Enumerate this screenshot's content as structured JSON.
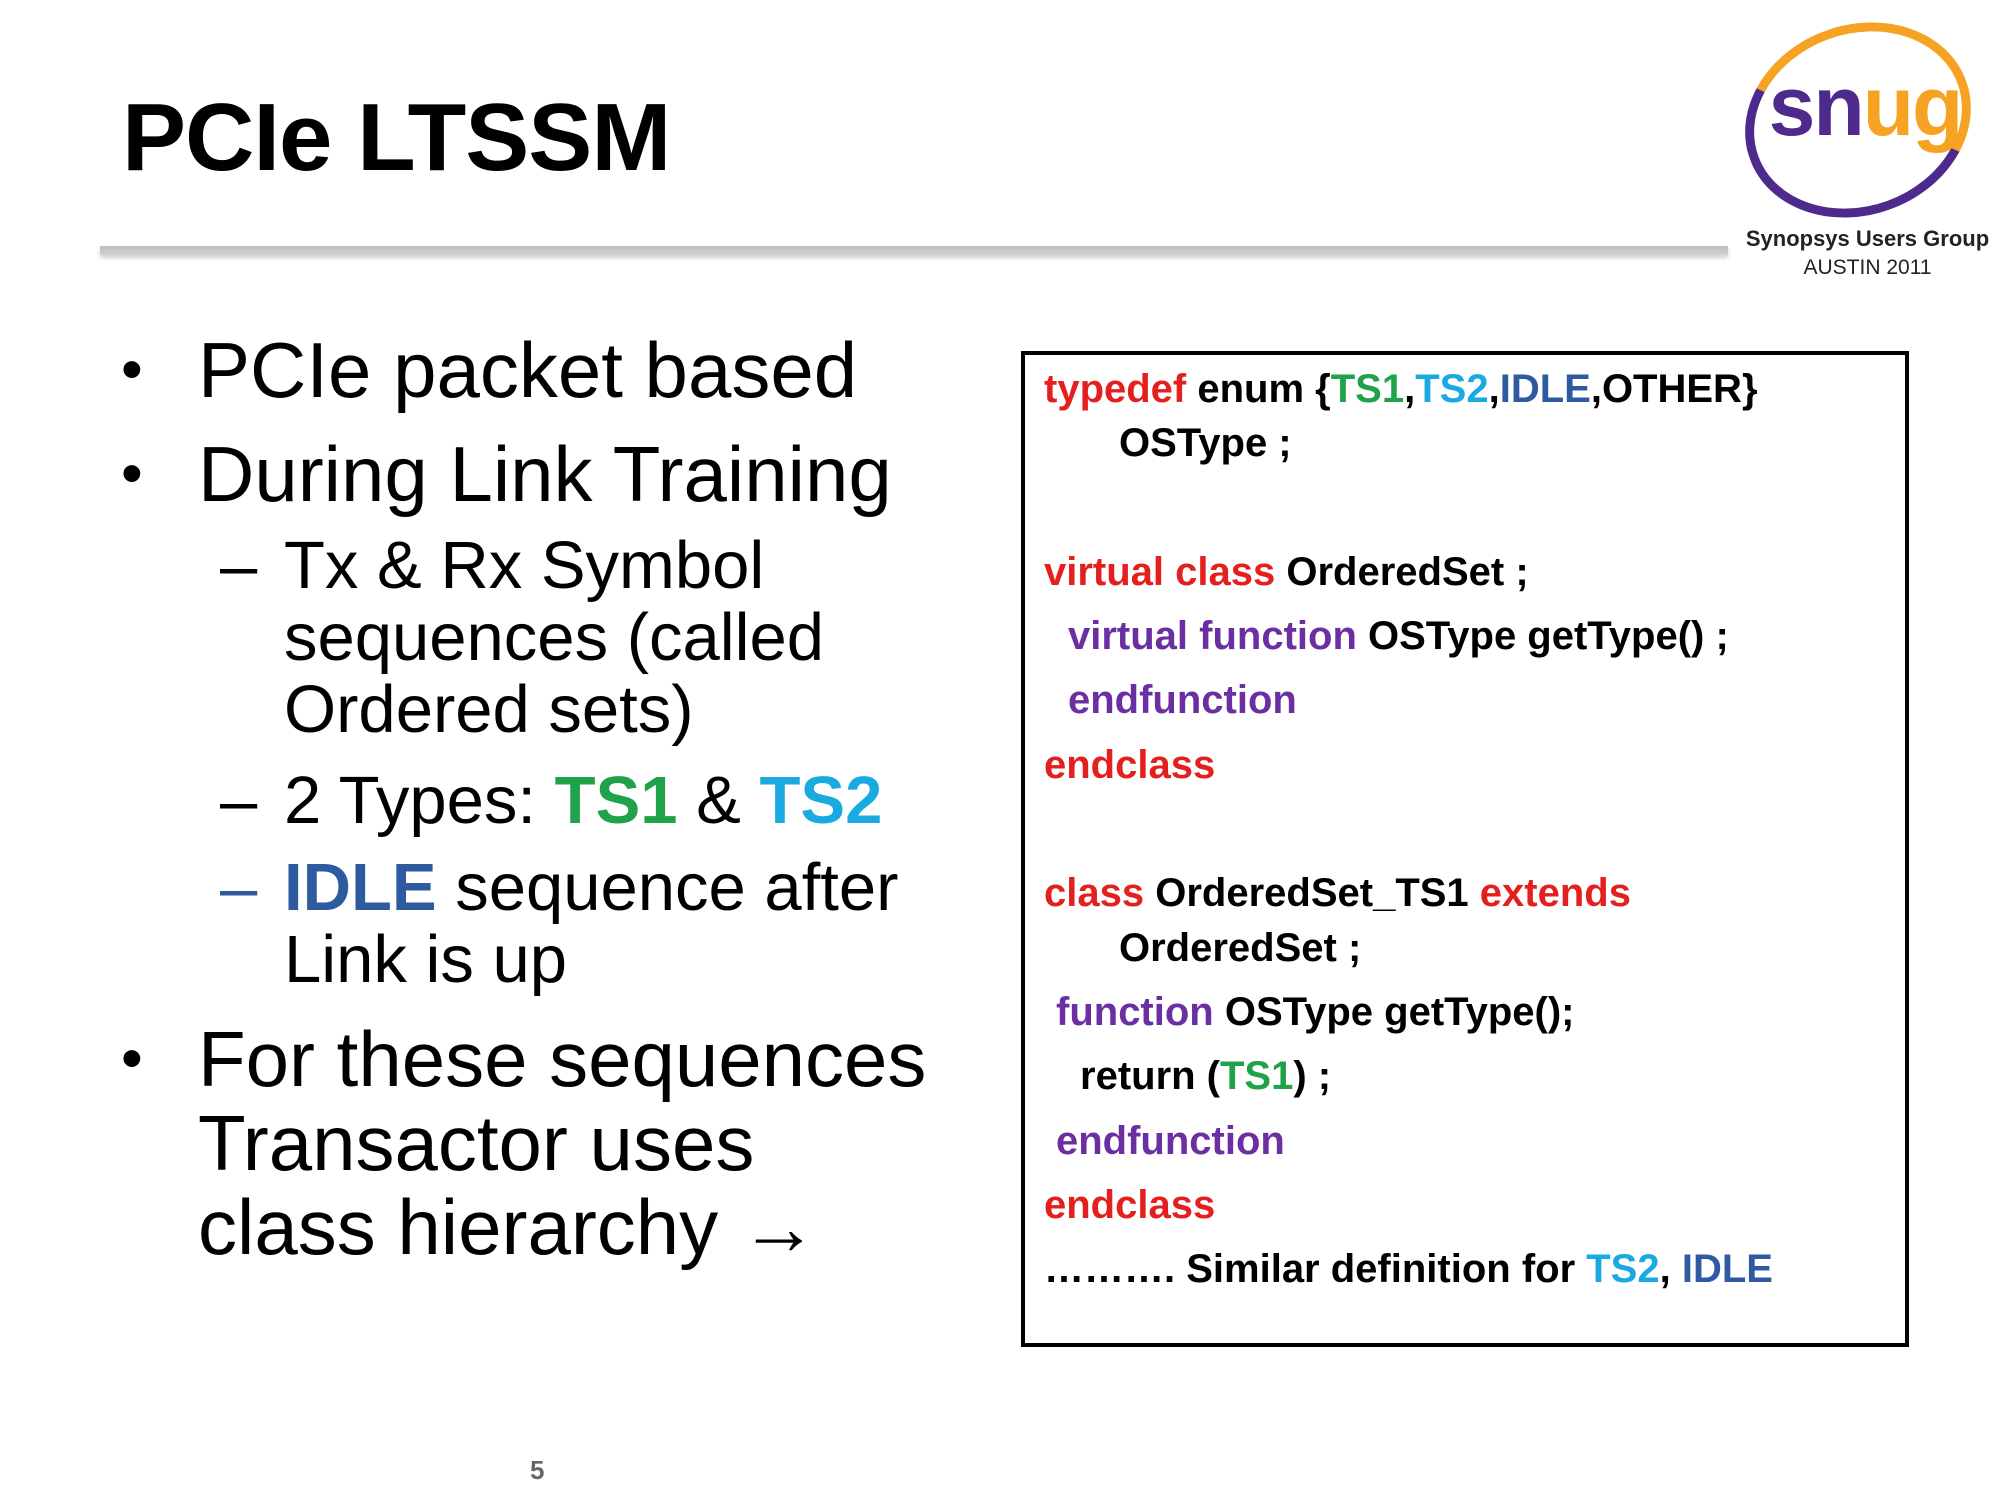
{
  "slide": {
    "title": "PCIe LTSSM",
    "page_number": "5"
  },
  "logo": {
    "word_part1": "sn",
    "word_part2": "ug",
    "org": "Synopsys Users Group",
    "event": "AUSTIN 2011",
    "colors": {
      "purple": "#4d2a8c",
      "orange": "#f6a324"
    }
  },
  "bullets": {
    "b1": "PCIe packet based",
    "b2": "During Link Training",
    "sub1_line1": "Tx & Rx Symbol",
    "sub1_line2": "sequences (called",
    "sub1_line3": "Ordered sets)",
    "sub2_prefix": "2 Types: ",
    "sub2_ts1": "TS1",
    "sub2_amp": " & ",
    "sub2_ts2": "TS2",
    "sub3_idle": "IDLE",
    "sub3_rest": " sequence after",
    "sub3_line2": "Link is up",
    "b3_line1": "For these sequences",
    "b3_line2": "Transactor  uses",
    "b3_line3": "class hierarchy →",
    "bullet_glyph": "•",
    "dash_glyph": "–"
  },
  "code": {
    "l1_typedef": "typedef",
    "l1_enum": " enum {",
    "l1_ts1": "TS1",
    "l1_c1": ",",
    "l1_ts2": "TS2",
    "l1_c2": ",",
    "l1_idle": "IDLE",
    "l1_other": ",OTHER}",
    "l2": "OSType ;",
    "l3_kw": "virtual class",
    "l3_rest": " OrderedSet ;",
    "l4_kw": "virtual function",
    "l4_rest": " OSType getType() ;",
    "l5": "endfunction",
    "l6": "endclass",
    "l7_kw": "class",
    "l7_mid": " OrderedSet_TS1 ",
    "l7_ext": "extends",
    "l8": "OrderedSet ;",
    "l9_kw": "function",
    "l9_rest": " OSType getType();",
    "l10_pre": "return (",
    "l10_ts1": "TS1",
    "l10_post": ") ;",
    "l11": "endfunction",
    "l12": "endclass",
    "l13_pre": "………. Similar definition for ",
    "l13_ts2": "TS2",
    "l13_comma": ", ",
    "l13_idle": "IDLE"
  },
  "colors": {
    "keyword_red": "#e4201e",
    "keyword_purple": "#6b2fa2",
    "ts1_green": "#1fa24a",
    "ts2_cyan": "#1aa9e0",
    "idle_blue": "#2e5aa0"
  }
}
